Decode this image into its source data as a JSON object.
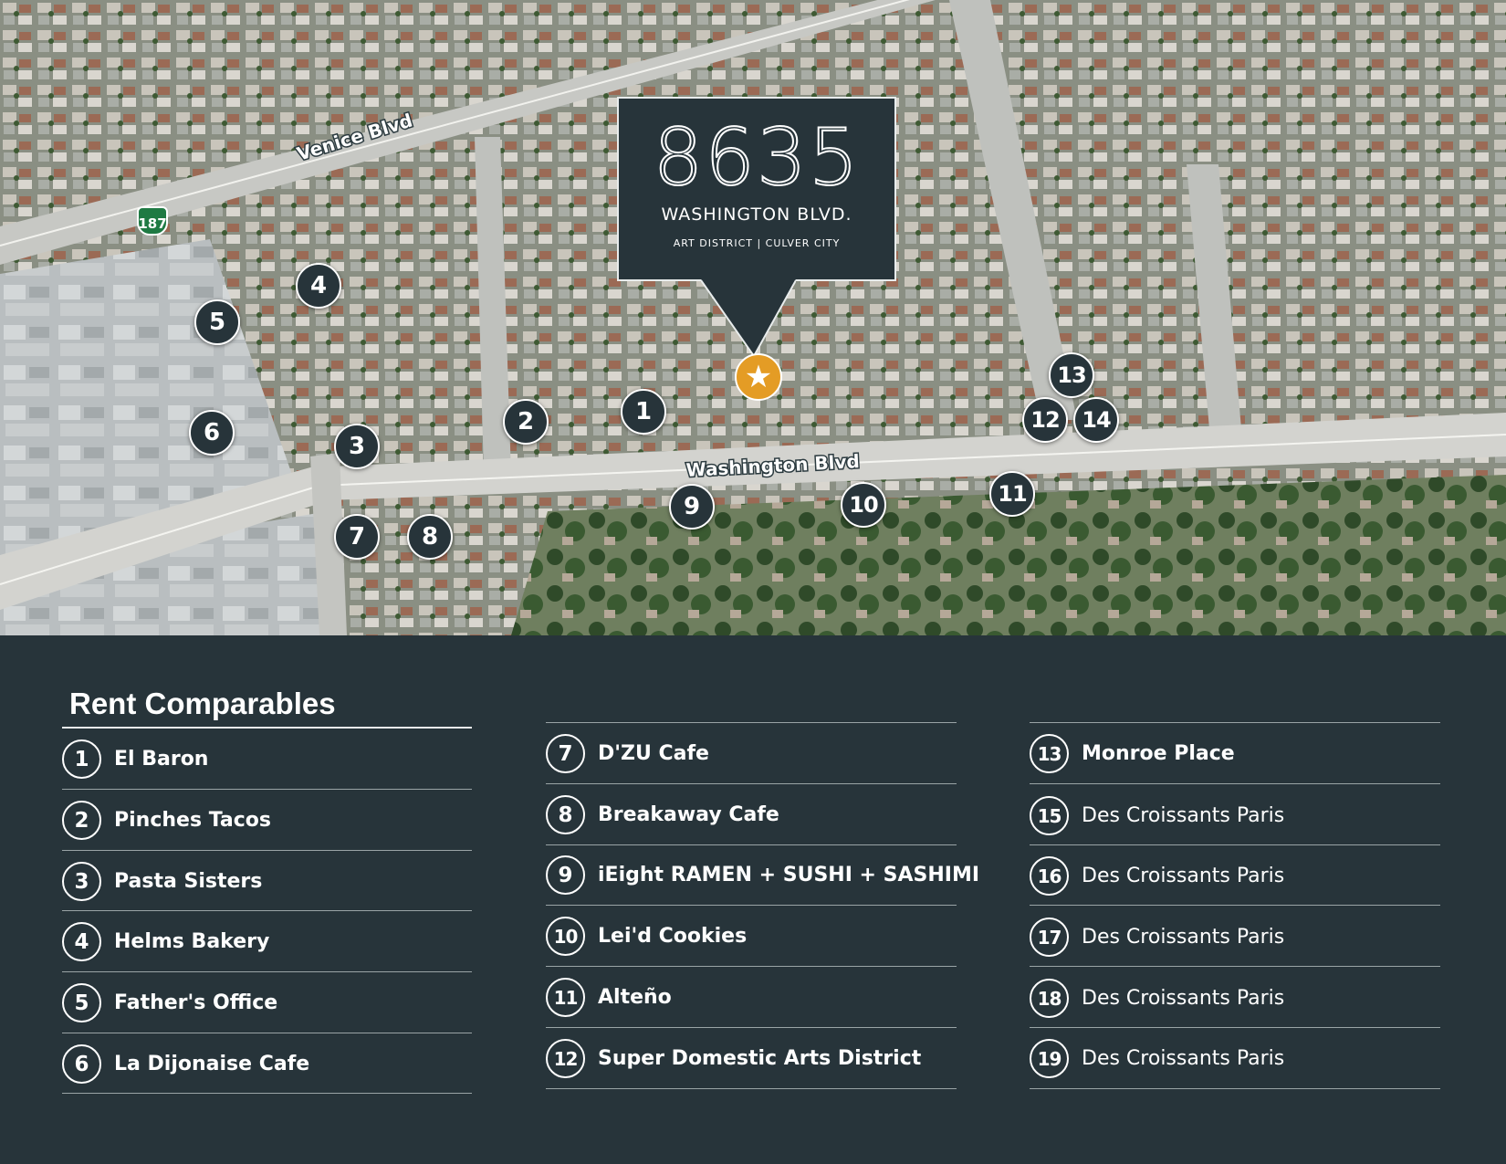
{
  "map": {
    "road_labels": [
      "Venice Blvd",
      "Washington Blvd"
    ],
    "highway_shield": "187",
    "callout": {
      "number": "8635",
      "street": "WASHINGTON BLVD.",
      "district": "ART DISTRICT | CULVER CITY"
    },
    "subject_marker_icon": "star-icon",
    "subject_marker_color": "#e49c25",
    "pins": [
      "1",
      "2",
      "3",
      "4",
      "5",
      "6",
      "7",
      "8",
      "9",
      "10",
      "11",
      "12",
      "13",
      "14"
    ]
  },
  "legend": {
    "title": "Rent Comparables",
    "columns": [
      [
        {
          "number": "1",
          "name": "El Baron",
          "bold": true
        },
        {
          "number": "2",
          "name": "Pinches Tacos",
          "bold": true
        },
        {
          "number": "3",
          "name": "Pasta Sisters",
          "bold": true
        },
        {
          "number": "4",
          "name": "Helms Bakery",
          "bold": true
        },
        {
          "number": "5",
          "name": "Father's Office",
          "bold": true
        },
        {
          "number": "6",
          "name": "La Dijonaise Cafe",
          "bold": true
        }
      ],
      [
        {
          "number": "7",
          "name": "D'ZU Cafe",
          "bold": true
        },
        {
          "number": "8",
          "name": "Breakaway Cafe",
          "bold": true
        },
        {
          "number": "9",
          "name": "iEight RAMEN + SUSHI + SASHIMI",
          "bold": true
        },
        {
          "number": "10",
          "name": "Lei'd Cookies",
          "bold": true
        },
        {
          "number": "11",
          "name": "Alteño",
          "bold": true
        },
        {
          "number": "12",
          "name": "Super Domestic Arts District",
          "bold": true
        }
      ],
      [
        {
          "number": "13",
          "name": "Monroe Place",
          "bold": true
        },
        {
          "number": "15",
          "name": "Des Croissants Paris",
          "bold": false
        },
        {
          "number": "16",
          "name": "Des Croissants Paris",
          "bold": false
        },
        {
          "number": "17",
          "name": "Des Croissants Paris",
          "bold": false
        },
        {
          "number": "18",
          "name": "Des Croissants Paris",
          "bold": false
        },
        {
          "number": "19",
          "name": "Des Croissants Paris",
          "bold": false
        }
      ]
    ]
  },
  "colors": {
    "panel": "#27343a",
    "accent": "#e49c25",
    "rule": "#9aa4a6"
  }
}
